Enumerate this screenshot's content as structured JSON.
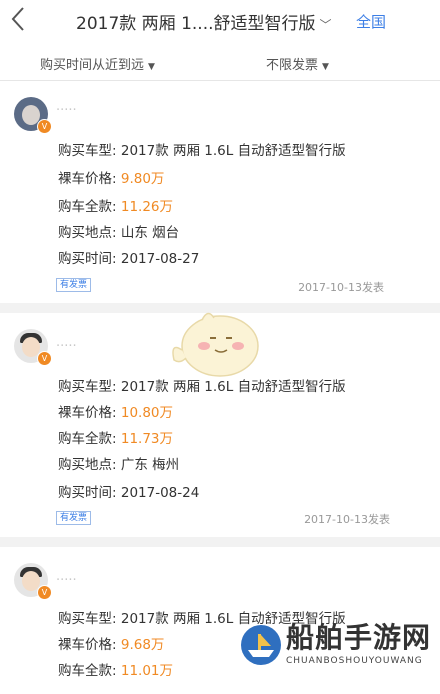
{
  "header": {
    "back_icon": "chevron-left-icon",
    "title": "2017款 两厢 1....舒适型智行版",
    "title_chevron": "﹀",
    "city": "全国"
  },
  "filters": {
    "sort": "购买时间从近到远",
    "invoice": "不限发票"
  },
  "labels": {
    "model": "购买车型:",
    "price": "裸车价格:",
    "total": "购车全款:",
    "place": "购买地点:",
    "time": "购买时间:",
    "badge": "有发票"
  },
  "entries": [
    {
      "model": "2017款 两厢 1.6L 自动舒适型智行版",
      "price": "9.80万",
      "total": "11.26万",
      "place": "山东 烟台",
      "time": "2017-08-27",
      "posted": "2017-10-13发表"
    },
    {
      "model": "2017款 两厢 1.6L 自动舒适型智行版",
      "price": "10.80万",
      "total": "11.73万",
      "place": "广东 梅州",
      "time": "2017-08-24",
      "posted": "2017-10-13发表"
    },
    {
      "model": "2017款 两厢 1.6L 自动舒适型智行版",
      "price": "9.68万",
      "total": "11.01万"
    }
  ],
  "watermark": {
    "name": "船舶手游网",
    "sub": "CHUANBOSHOUYOUWANG"
  },
  "colors": {
    "accent": "#3d7fe6",
    "price": "#f08a24"
  }
}
